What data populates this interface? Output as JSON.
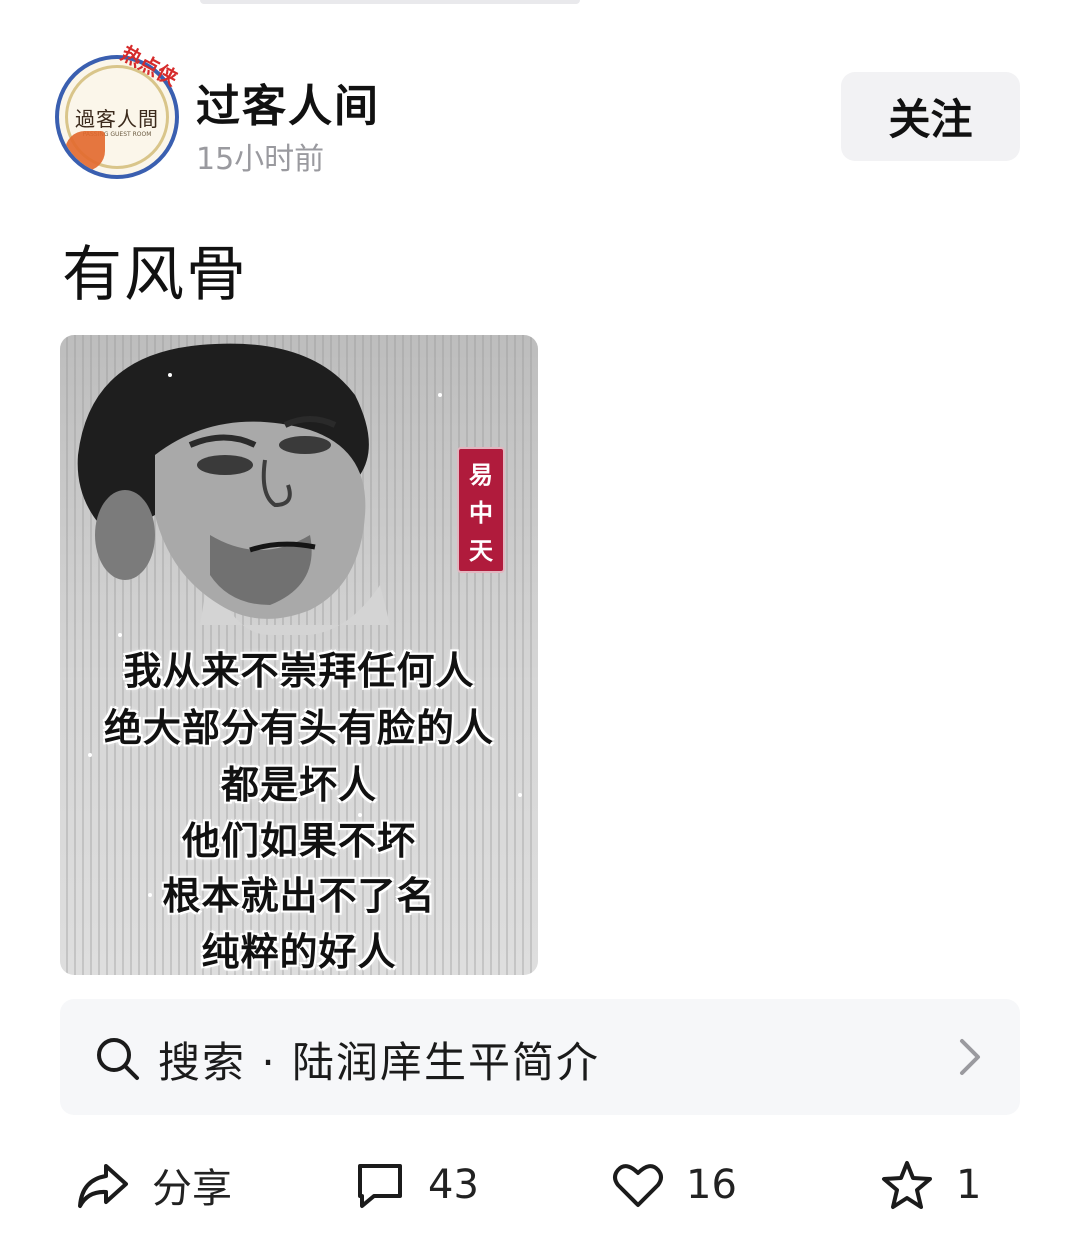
{
  "author": {
    "name": "过客人间",
    "time": "15小时前",
    "avatar_text": "過客人間",
    "avatar_subtext": "PASSING GUEST ROOM",
    "badge": "热点侠",
    "follow_label": "关注"
  },
  "post": {
    "text": "有风骨",
    "image": {
      "name_tag": [
        "易",
        "中",
        "天"
      ],
      "quote_lines": [
        "我从来不崇拜任何人",
        "绝大部分有头有脸的人",
        "都是坏人",
        "他们如果不坏",
        "根本就出不了名",
        "纯粹的好人"
      ]
    }
  },
  "search": {
    "text": "搜索 · 陆润庠生平简介"
  },
  "actions": {
    "share_label": "分享",
    "comment_count": "43",
    "like_count": "16",
    "favorite_count": "1"
  },
  "icons": {
    "search": "search-icon",
    "chevron": "chevron-right-icon",
    "share": "share-icon",
    "comment": "comment-icon",
    "like": "heart-icon",
    "favorite": "star-icon"
  }
}
